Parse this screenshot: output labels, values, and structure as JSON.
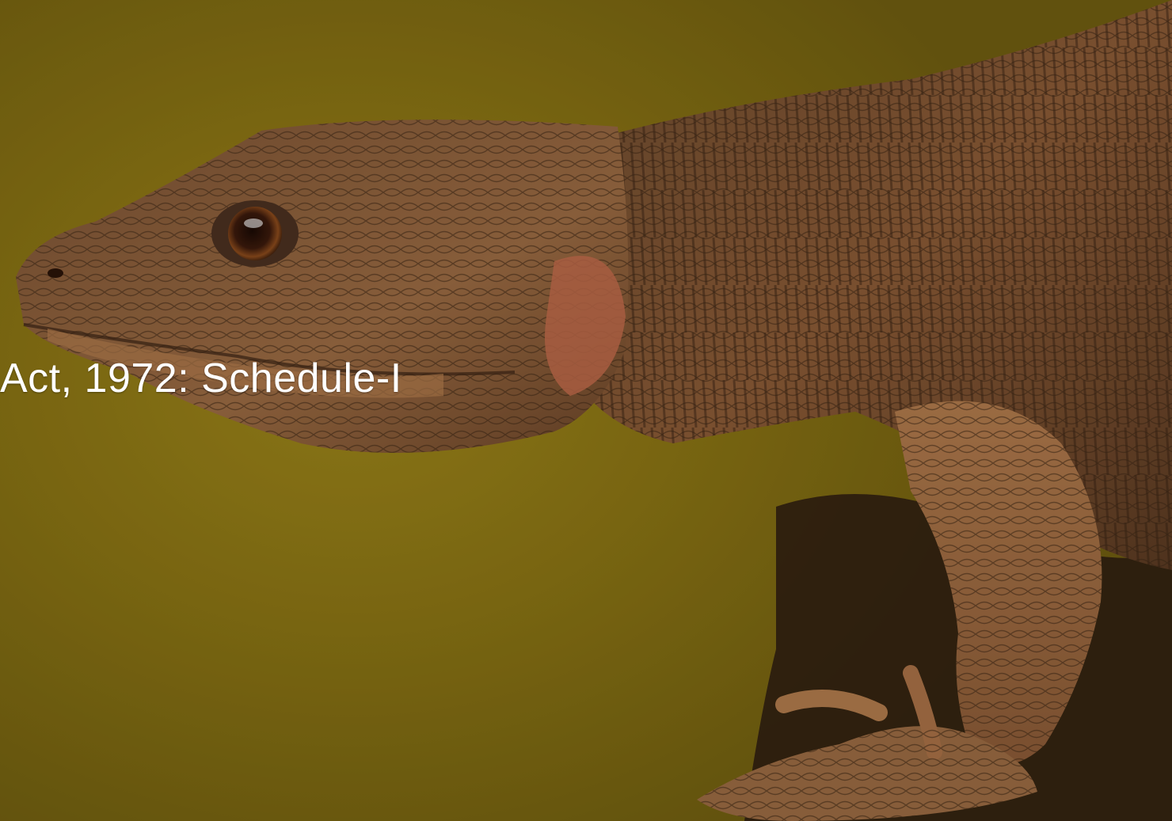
{
  "slide": {
    "caption": "Act, 1972: Schedule-I"
  },
  "photo": {
    "subject": "lizard-photo"
  },
  "colors": {
    "background": "#8a7414",
    "skin_dark": "#4a3320",
    "skin_mid": "#8a5a36",
    "skin_light": "#b07a4c",
    "throat": "#c06a4a",
    "eye": "#3b1a0c"
  }
}
